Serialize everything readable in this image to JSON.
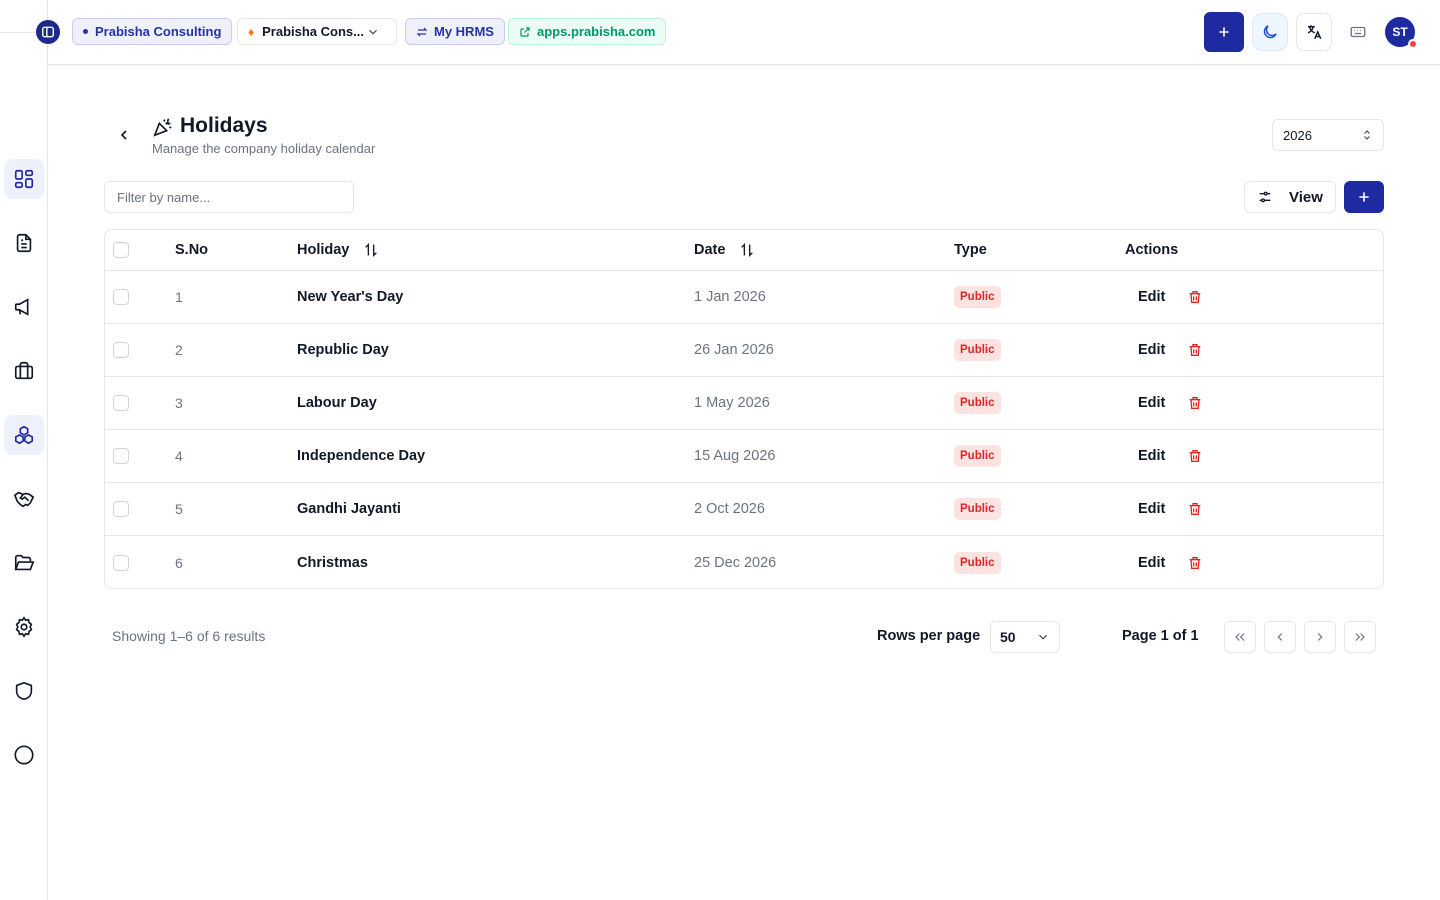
{
  "topbar": {
    "org_chip": "Prabisha Consulting",
    "company_select": "Prabisha Cons...",
    "hrms_chip": "My HRMS",
    "link_chip": "apps.prabisha.com",
    "avatar_initials": "ST"
  },
  "sidebar": {
    "items": [
      {
        "icon": "dashboard-icon",
        "active": true
      },
      {
        "icon": "document-icon",
        "active": false
      },
      {
        "icon": "megaphone-icon",
        "active": false
      },
      {
        "icon": "briefcase-icon",
        "active": false
      },
      {
        "icon": "boxes-icon",
        "active": true
      },
      {
        "icon": "handshake-icon",
        "active": false
      },
      {
        "icon": "folder-open-icon",
        "active": false
      },
      {
        "icon": "gear-icon",
        "active": false
      },
      {
        "icon": "shield-icon",
        "active": false
      },
      {
        "icon": "circle-icon",
        "active": false
      }
    ]
  },
  "header": {
    "title": "Holidays",
    "subtitle": "Manage the company holiday calendar",
    "year": "2026"
  },
  "toolbar": {
    "filter_placeholder": "Filter by name...",
    "view_label": "View"
  },
  "table": {
    "columns": {
      "sno": "S.No",
      "holiday": "Holiday",
      "date": "Date",
      "type": "Type",
      "actions": "Actions"
    },
    "edit_label": "Edit",
    "rows": [
      {
        "sno": "1",
        "holiday": "New Year's Day",
        "date": "1 Jan 2026",
        "type": "Public"
      },
      {
        "sno": "2",
        "holiday": "Republic Day",
        "date": "26 Jan 2026",
        "type": "Public"
      },
      {
        "sno": "3",
        "holiday": "Labour Day",
        "date": "1 May 2026",
        "type": "Public"
      },
      {
        "sno": "4",
        "holiday": "Independence Day",
        "date": "15 Aug 2026",
        "type": "Public"
      },
      {
        "sno": "5",
        "holiday": "Gandhi Jayanti",
        "date": "2 Oct 2026",
        "type": "Public"
      },
      {
        "sno": "6",
        "holiday": "Christmas",
        "date": "25 Dec 2026",
        "type": "Public"
      }
    ]
  },
  "footer": {
    "showing": "Showing 1–6 of 6 results",
    "rows_per_page_label": "Rows per page",
    "rows_per_page": "50",
    "page_info": "Page 1 of 1"
  },
  "colors": {
    "primary": "#1e2aa0",
    "badge_bg": "#fde2e2",
    "badge_text": "#dc2626",
    "link_green": "#059669"
  }
}
